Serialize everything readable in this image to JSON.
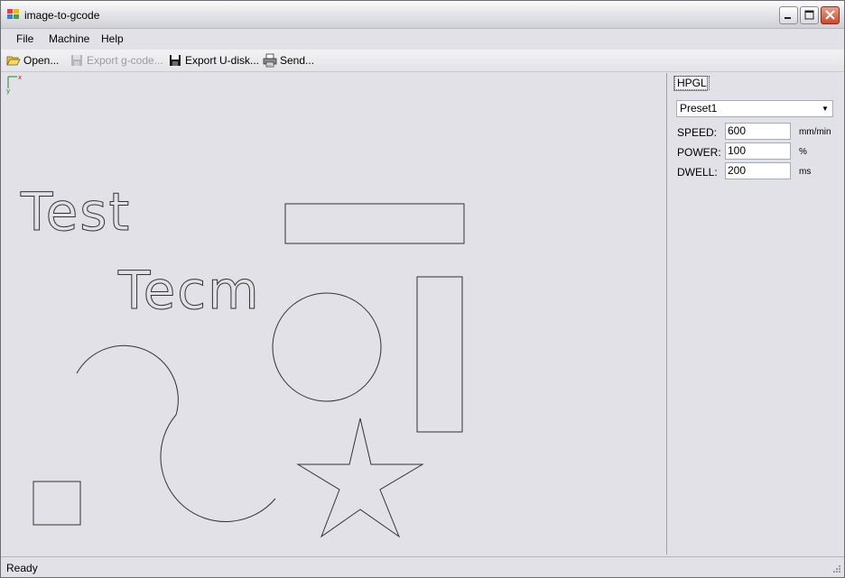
{
  "window": {
    "title": "image-to-gcode"
  },
  "menu": {
    "items": [
      "File",
      "Machine",
      "Help"
    ]
  },
  "toolbar": {
    "open_label": "Open...",
    "export_gcode_label": "Export g-code...",
    "export_udisk_label": "Export U-disk...",
    "send_label": "Send..."
  },
  "canvas": {
    "axis_x_label": "x",
    "axis_y_label": "y",
    "text_1": "Test",
    "text_2": "Tecm"
  },
  "panel": {
    "tab_label": "HPGL",
    "preset_value": "Preset1",
    "speed_label": "SPEED:",
    "speed_value": "600",
    "speed_unit": "mm/min",
    "power_label": "POWER:",
    "power_value": "100",
    "power_unit": "%",
    "dwell_label": "DWELL:",
    "dwell_value": "200",
    "dwell_unit": "ms"
  },
  "status": {
    "text": "Ready"
  },
  "colors": {
    "close_button": "#c74b2c",
    "background": "#e2e1e7",
    "stroke": "#333333"
  }
}
